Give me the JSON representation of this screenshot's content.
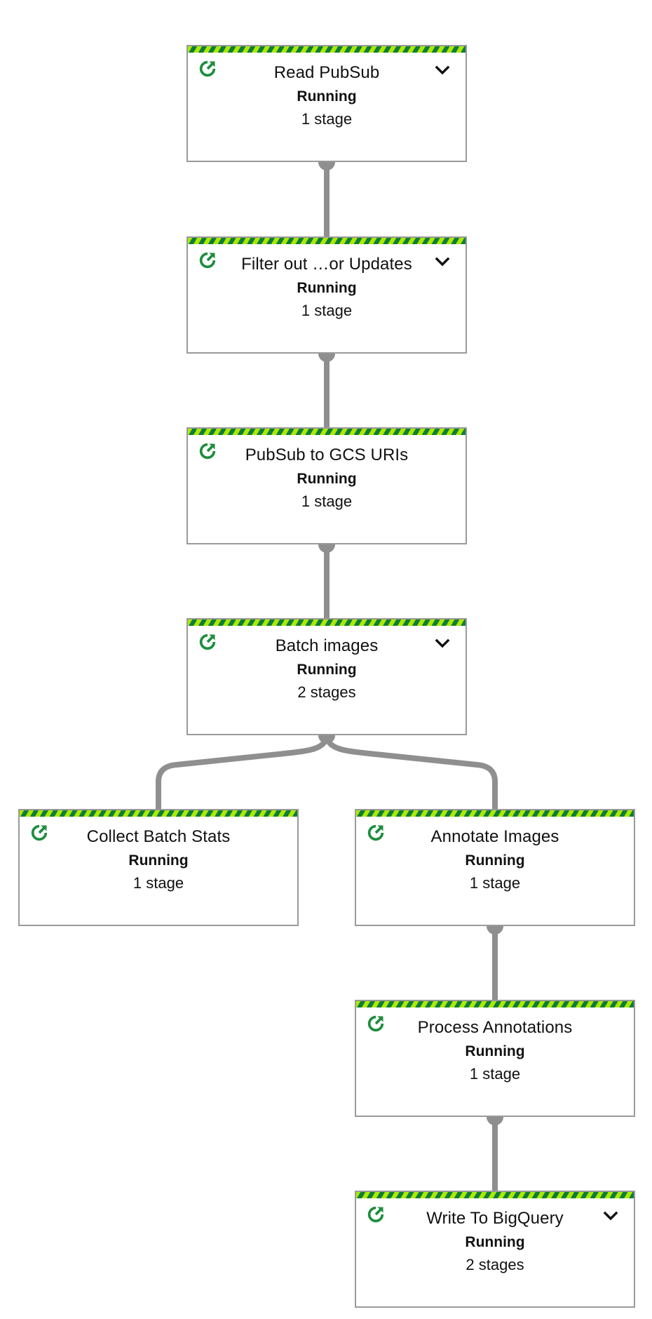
{
  "colors": {
    "running_icon": "#1e8e3e",
    "stripe_dark": "#0b7d3e",
    "stripe_light": "#aee800",
    "connector": "#8f8f8f",
    "border": "#9a9a9a"
  },
  "nodes": [
    {
      "id": "read-pubsub",
      "title": "Read PubSub",
      "status": "Running",
      "stages": "1 stage",
      "expandable": true
    },
    {
      "id": "filter-out-updates",
      "title": "Filter out …or Updates",
      "status": "Running",
      "stages": "1 stage",
      "expandable": true
    },
    {
      "id": "pubsub-to-gcs-uris",
      "title": "PubSub to GCS URIs",
      "status": "Running",
      "stages": "1 stage",
      "expandable": false
    },
    {
      "id": "batch-images",
      "title": "Batch images",
      "status": "Running",
      "stages": "2 stages",
      "expandable": true
    },
    {
      "id": "collect-batch-stats",
      "title": "Collect Batch Stats",
      "status": "Running",
      "stages": "1 stage",
      "expandable": false
    },
    {
      "id": "annotate-images",
      "title": "Annotate Images",
      "status": "Running",
      "stages": "1 stage",
      "expandable": false
    },
    {
      "id": "process-annotations",
      "title": "Process Annotations",
      "status": "Running",
      "stages": "1 stage",
      "expandable": false
    },
    {
      "id": "write-to-bigquery",
      "title": "Write To BigQuery",
      "status": "Running",
      "stages": "2 stages",
      "expandable": true
    }
  ],
  "edges": [
    {
      "from": "read-pubsub",
      "to": "filter-out-updates"
    },
    {
      "from": "filter-out-updates",
      "to": "pubsub-to-gcs-uris"
    },
    {
      "from": "pubsub-to-gcs-uris",
      "to": "batch-images"
    },
    {
      "from": "batch-images",
      "to": "collect-batch-stats"
    },
    {
      "from": "batch-images",
      "to": "annotate-images"
    },
    {
      "from": "annotate-images",
      "to": "process-annotations"
    },
    {
      "from": "process-annotations",
      "to": "write-to-bigquery"
    }
  ]
}
